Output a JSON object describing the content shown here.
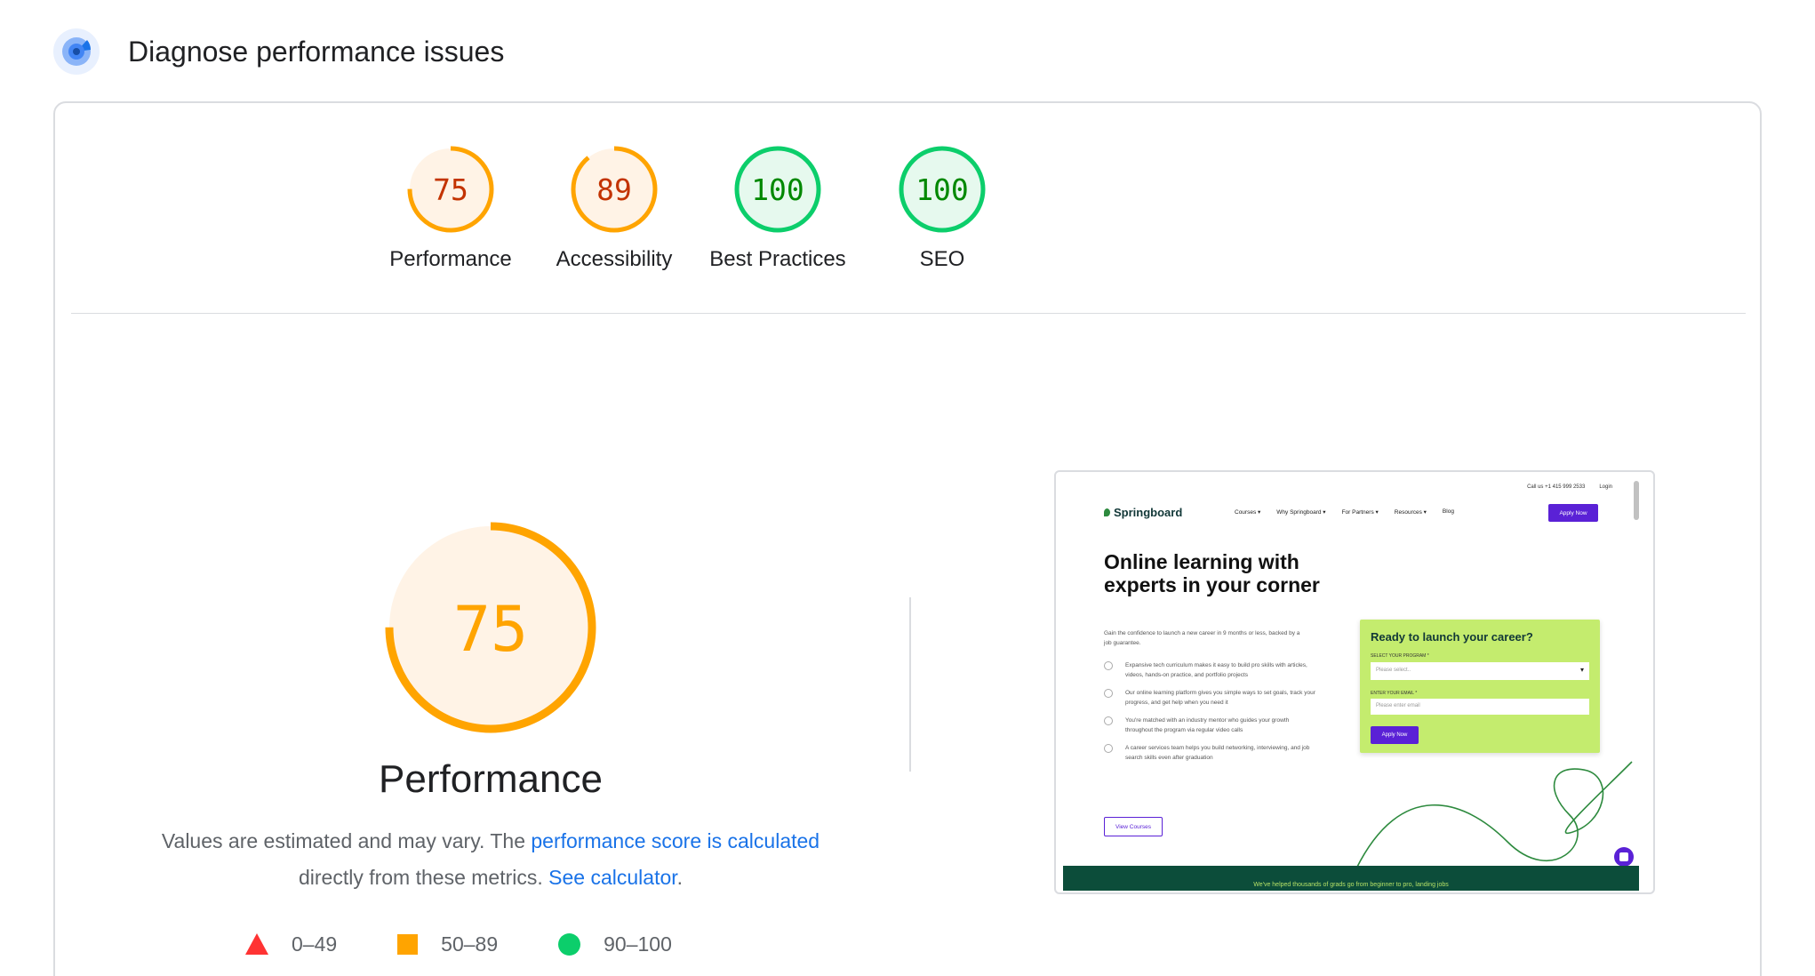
{
  "header": {
    "title": "Diagnose performance issues",
    "icon": "lighthouse-gauge-icon"
  },
  "gauges": [
    {
      "label": "Performance",
      "score": "75",
      "value": 75,
      "status": "average"
    },
    {
      "label": "Accessibility",
      "score": "89",
      "value": 89,
      "status": "average"
    },
    {
      "label": "Best Practices",
      "score": "100",
      "value": 100,
      "status": "pass"
    },
    {
      "label": "SEO",
      "score": "100",
      "value": 100,
      "status": "pass"
    }
  ],
  "performance": {
    "score": "75",
    "value": 75,
    "title": "Performance",
    "desc_part1": "Values are estimated and may vary. The ",
    "desc_link1": "performance score is calculated",
    "desc_part2": " directly from these metrics. ",
    "desc_link2": "See calculator",
    "desc_part3": "."
  },
  "legend": [
    {
      "range": "0–49",
      "shape": "triangle",
      "color": "#ff3333"
    },
    {
      "range": "50–89",
      "shape": "square",
      "color": "#ffa400"
    },
    {
      "range": "90–100",
      "shape": "circle",
      "color": "#0cce6b"
    }
  ],
  "colors": {
    "average_stroke": "#ffa400",
    "average_text": "#c33300",
    "average_fill": "#fff3e6",
    "pass_stroke": "#0cce6b",
    "pass_text": "#008800",
    "pass_fill": "#e6f9ee",
    "link": "#1a73e8"
  },
  "thumbnail": {
    "call_us": "Call us +1 415 999 2533",
    "login": "Login",
    "logo": "Springboard",
    "nav": [
      "Courses ▾",
      "Why Springboard ▾",
      "For Partners ▾",
      "Resources ▾",
      "Blog"
    ],
    "apply": "Apply Now",
    "headline": "Online learning with experts in your corner",
    "sub": "Gain the confidence to launch a new career in 9 months or less, backed by a job guarantee.",
    "bullets": [
      "Expansive tech curriculum makes it easy to build pro skills with articles, videos, hands-on practice, and portfolio projects",
      "Our online learning platform gives you simple ways to set goals, track your progress, and get help when you need it",
      "You're matched with an industry mentor who guides your growth throughout the program via regular video calls",
      "A career services team helps you build networking, interviewing, and job search skills even after graduation"
    ],
    "view_courses": "View Courses",
    "form_title": "Ready to launch your career?",
    "form_program_label": "SELECT YOUR PROGRAM *",
    "form_program_placeholder": "Please select..",
    "form_email_label": "ENTER YOUR EMAIL *",
    "form_email_placeholder": "Please enter email",
    "form_button": "Apply Now",
    "bottom_bar": "We've helped thousands of grads go from beginner to pro, landing jobs"
  }
}
